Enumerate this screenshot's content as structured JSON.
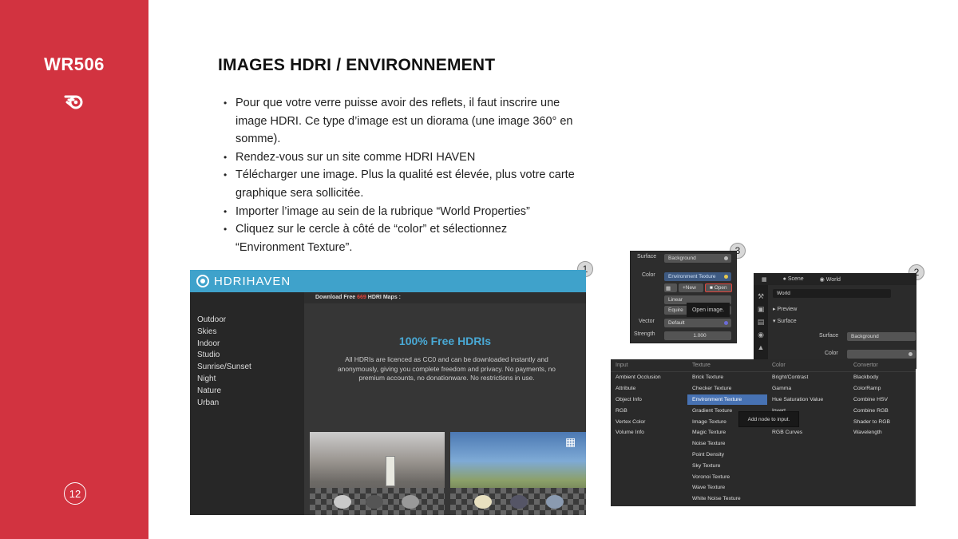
{
  "sidebar": {
    "brand": "WR506",
    "page_number": "12",
    "bg_color": "#d23340"
  },
  "slide": {
    "title": "IMAGES HDRI / ENVIRONNEMENT",
    "bullets": [
      "Pour que votre verre puisse avoir des reflets, il faut inscrire une image HDRI. Ce type d’image est un diorama (une image 360° en somme).",
      "Rendez-vous sur un site comme HDRI HAVEN",
      "Télécharger une image. Plus la qualité est élevée, plus votre carte graphique sera sollicitée.",
      "Importer l’image au sein de la rubrique “World Properties”",
      "Cliquez sur le cercle à côté de “color” et sélectionnez “Environment Texture”."
    ]
  },
  "badges": [
    "1",
    "2",
    "3"
  ],
  "hdrihaven": {
    "logo_text": "HDRIHAVEN",
    "categories": [
      "Outdoor",
      "Skies",
      "Indoor",
      "Studio",
      "Sunrise/Sunset",
      "Night",
      "Nature",
      "Urban"
    ],
    "strip_prefix": "Download Free ",
    "strip_count": "669",
    "strip_suffix": " HDRI Maps :",
    "heading": "100% Free HDRIs",
    "paragraph": "All HDRIs are licenced as CC0 and can be downloaded instantly and anonymously, giving you complete freedom and privacy. No payments, no premium accounts, no donationware. No restrictions in use.",
    "accent_color": "#3fa2cb"
  },
  "panel3": {
    "surface_label": "Surface",
    "surface_value": "Background",
    "color_label": "Color",
    "color_value": "Environment Texture",
    "new_label": "New",
    "open_label": "Open",
    "linear_value": "Linear",
    "equirect_value": "Equire",
    "open_tooltip": "Open image.",
    "vector_label": "Vector",
    "vector_value": "Default",
    "strength_label": "Strength",
    "strength_value": "1.000"
  },
  "panel2": {
    "scene_tab": "Scene",
    "world_tab": "World",
    "world_name": "World",
    "preview_label": "Preview",
    "surface_section": "Surface",
    "surface_label": "Surface",
    "surface_value": "Background",
    "color_label": "Color"
  },
  "node_menu": {
    "columns": [
      {
        "head": "Input",
        "items": [
          "Ambient Occlusion",
          "Attribute",
          "Object Info",
          "RGB",
          "Vertex Color",
          "Volume Info"
        ]
      },
      {
        "head": "Texture",
        "items": [
          "Brick Texture",
          "Checker Texture",
          "Environment Texture",
          "Gradient Texture",
          "Image Texture",
          "Magic Texture",
          "Noise Texture",
          "Point Density",
          "Sky Texture",
          "Voronoi Texture",
          "Wave Texture",
          "White Noise Texture"
        ]
      },
      {
        "head": "Color",
        "items": [
          "Bright/Contrast",
          "Gamma",
          "Hue Saturation Value",
          "Invert",
          "",
          "RGB Curves"
        ]
      },
      {
        "head": "Convertor",
        "items": [
          "Blackbody",
          "ColorRamp",
          "Combine HSV",
          "Combine RGB",
          "Shader to RGB",
          "Wavelength"
        ]
      }
    ],
    "selected": "Environment Texture",
    "tooltip": "Add node to input."
  }
}
